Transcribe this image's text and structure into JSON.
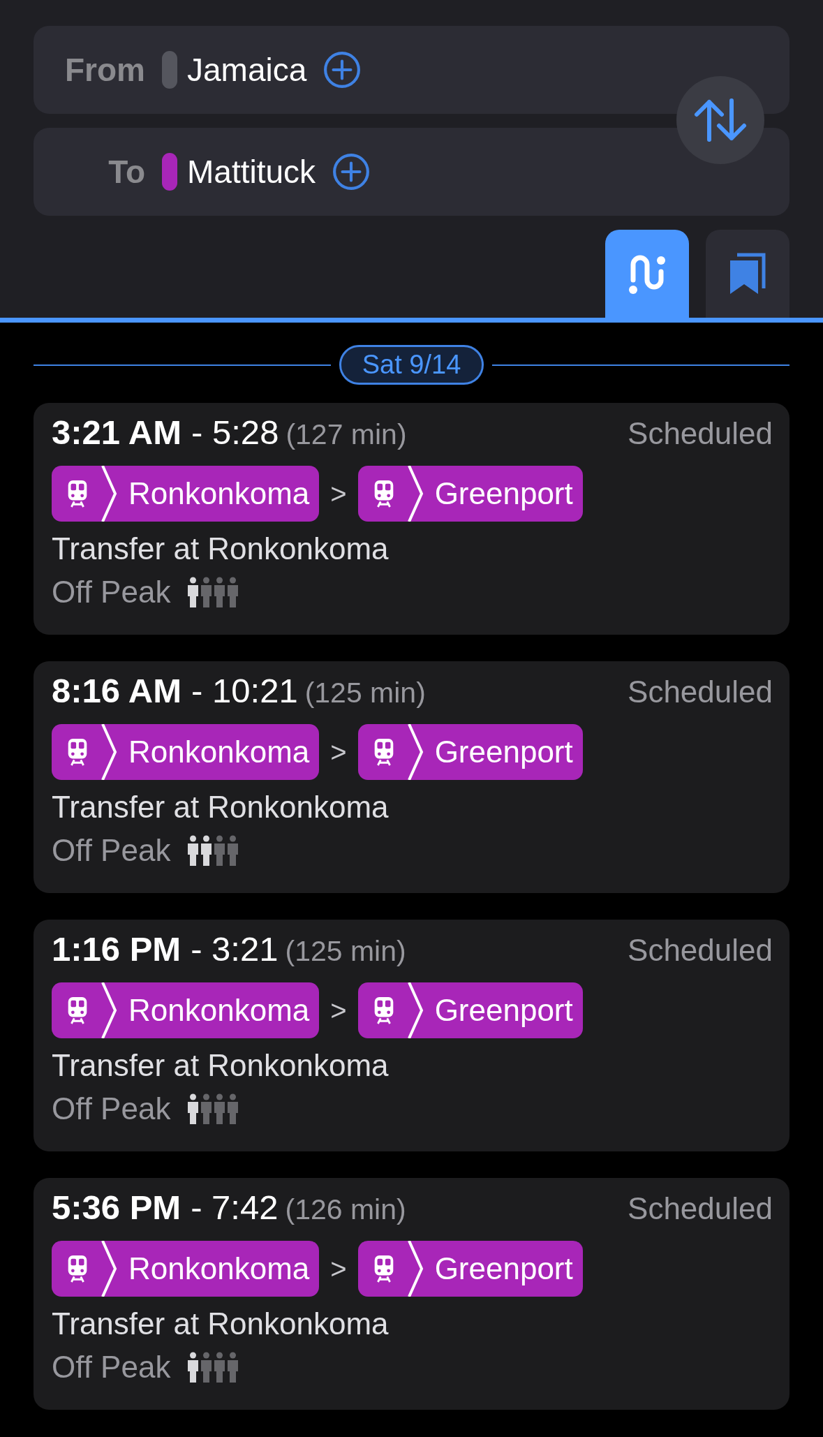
{
  "from": {
    "label": "From",
    "station": "Jamaica",
    "color": "#55565e"
  },
  "to": {
    "label": "To",
    "station": "Mattituck",
    "color": "#a826b8"
  },
  "tabs": [
    {
      "kind": "routes",
      "selected": true
    },
    {
      "kind": "saved",
      "selected": false
    }
  ],
  "date": "Sat 9/14",
  "trips": [
    {
      "depart": "3:21 AM",
      "arrive": "- 5:28",
      "duration": "(127 min)",
      "status": "Scheduled",
      "legs": [
        "Ronkonkoma",
        "Greenport"
      ],
      "separator": ">",
      "note": "Transfer at Ronkonkoma",
      "fare": "Off Peak",
      "crowding": [
        {
          "filled": true
        },
        {
          "filled": false
        },
        {
          "filled": false
        },
        {
          "filled": false
        }
      ]
    },
    {
      "depart": "8:16 AM",
      "arrive": "- 10:21",
      "duration": "(125 min)",
      "status": "Scheduled",
      "legs": [
        "Ronkonkoma",
        "Greenport"
      ],
      "separator": ">",
      "note": "Transfer at Ronkonkoma",
      "fare": "Off Peak",
      "crowding": [
        {
          "filled": true
        },
        {
          "filled": true
        },
        {
          "filled": false
        },
        {
          "filled": false
        }
      ]
    },
    {
      "depart": "1:16 PM",
      "arrive": "- 3:21",
      "duration": "(125 min)",
      "status": "Scheduled",
      "legs": [
        "Ronkonkoma",
        "Greenport"
      ],
      "separator": ">",
      "note": "Transfer at Ronkonkoma",
      "fare": "Off Peak",
      "crowding": [
        {
          "filled": true
        },
        {
          "filled": false
        },
        {
          "filled": false
        },
        {
          "filled": false
        }
      ]
    },
    {
      "depart": "5:36 PM",
      "arrive": "- 7:42",
      "duration": "(126 min)",
      "status": "Scheduled",
      "legs": [
        "Ronkonkoma",
        "Greenport"
      ],
      "separator": ">",
      "note": "Transfer at Ronkonkoma",
      "fare": "Off Peak",
      "crowding": [
        {
          "filled": true
        },
        {
          "filled": false
        },
        {
          "filled": false
        },
        {
          "filled": false
        }
      ]
    }
  ]
}
